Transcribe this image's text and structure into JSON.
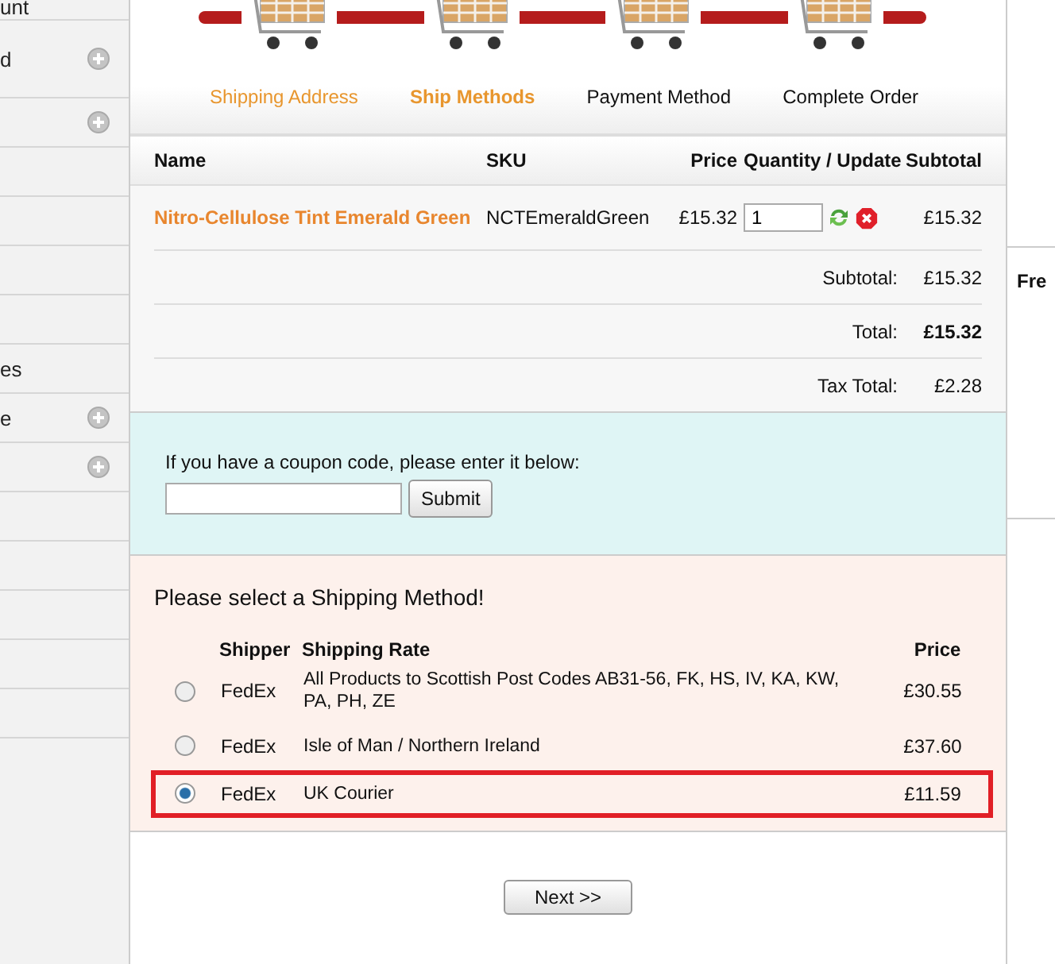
{
  "sidebar": {
    "items": [
      {
        "label": "unt",
        "expandable": false
      },
      {
        "label": "d",
        "expandable": true
      },
      {
        "expandable": true
      },
      {
        "expandable": false
      },
      {
        "expandable": false
      },
      {
        "expandable": false
      },
      {
        "expandable": false
      },
      {
        "label": "es",
        "expandable": false
      },
      {
        "label": "e",
        "expandable": true
      },
      {
        "expandable": true
      },
      {
        "expandable": false
      },
      {
        "expandable": false
      },
      {
        "expandable": false
      },
      {
        "expandable": false
      },
      {
        "expandable": false
      }
    ]
  },
  "steps": [
    {
      "label": "Shipping Address",
      "done": true,
      "selected": false
    },
    {
      "label": "Ship Methods",
      "done": false,
      "selected": true
    },
    {
      "label": "Payment Method",
      "done": false,
      "selected": false
    },
    {
      "label": "Complete Order",
      "done": false,
      "selected": false
    }
  ],
  "cart": {
    "columns": [
      "Name",
      "SKU",
      "Price",
      "Quantity / Update",
      "Subtotal"
    ],
    "rows": [
      {
        "name": "Nitro-Cellulose Tint Emerald Green",
        "sku": "NCTEmeraldGreen",
        "price": "£15.32",
        "quantity": "1",
        "subtotal": "£15.32"
      }
    ],
    "totals": [
      {
        "label": "Subtotal:",
        "value": "£15.32",
        "bold": false
      },
      {
        "label": "Total:",
        "value": "£15.32",
        "bold": true
      },
      {
        "label": "Tax Total:",
        "value": "£2.28",
        "bold": false
      }
    ]
  },
  "coupon": {
    "prompt": "If you have a coupon code, please enter it below:",
    "button": "Submit"
  },
  "shipping": {
    "title": "Please select a Shipping Method!",
    "columns": [
      "Shipper",
      "Shipping Rate",
      "Price"
    ],
    "options": [
      {
        "shipper": "FedEx",
        "rate": "All Products to Scottish Post Codes AB31-56, FK, HS, IV, KA, KW, PA, PH, ZE",
        "price": "£30.55",
        "selected": false
      },
      {
        "shipper": "FedEx",
        "rate": "Isle of Man / Northern Ireland",
        "price": "£37.60",
        "selected": false
      },
      {
        "shipper": "FedEx",
        "rate": "UK Courier",
        "price": "£11.59",
        "selected": true
      }
    ]
  },
  "next_button": "Next >>",
  "side_panel": {
    "heading": "Fre"
  }
}
